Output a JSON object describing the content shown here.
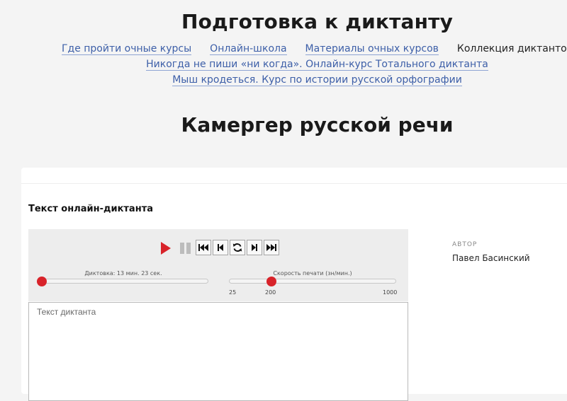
{
  "page_title": "Подготовка к диктанту",
  "nav": {
    "row1": [
      {
        "label": "Где пройти очные курсы",
        "current": false
      },
      {
        "label": "Онлайн-школа",
        "current": false
      },
      {
        "label": "Материалы очных курсов",
        "current": false
      },
      {
        "label": "Коллекция диктантов",
        "current": true
      }
    ],
    "row2": [
      {
        "label": "Никогда не пиши «ни когда». Онлайн-курс Тотального диктанта",
        "current": false
      }
    ],
    "row3": [
      {
        "label": "Мыш кродеться. Курс по истории русской орфографии",
        "current": false
      }
    ]
  },
  "section_title": "Камергер русской речи",
  "dictation": {
    "label": "Текст онлайн-диктанта",
    "textarea_placeholder": "Текст диктанта"
  },
  "player": {
    "progress": {
      "label": "Диктовка: 13 мин. 23 сек.",
      "position_fraction": 0.0
    },
    "speed": {
      "label": "Скорость печати (зн/мин.)",
      "min": 25,
      "max": 1000,
      "value": 200,
      "min_label": "25",
      "value_label": "200",
      "max_label": "1000"
    }
  },
  "author": {
    "label": "АВТОР",
    "name": "Павел Басинский"
  },
  "colors": {
    "accent": "#d8232a",
    "link": "#3d5fa8"
  },
  "icons": [
    "play-icon",
    "pause-icon",
    "skip-to-start-icon",
    "step-back-icon",
    "repeat-icon",
    "step-forward-icon",
    "skip-to-end-icon"
  ]
}
